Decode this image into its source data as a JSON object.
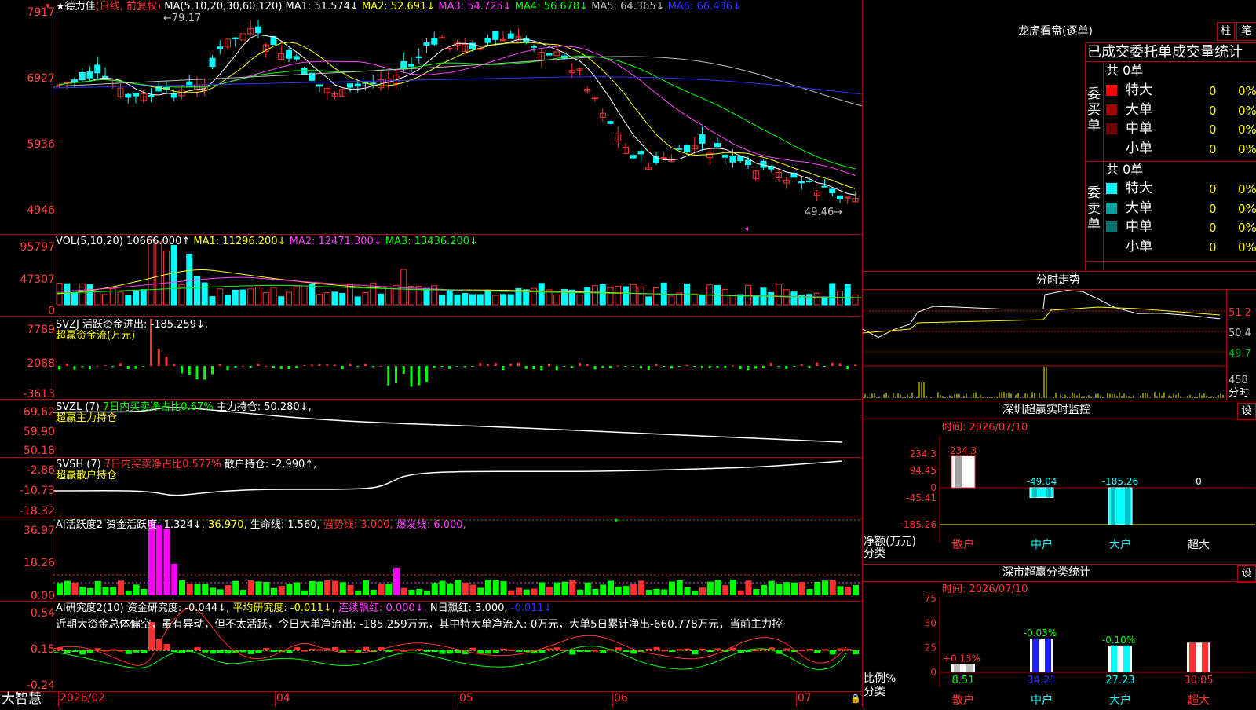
{
  "main": {
    "title_star": "★",
    "stock_name": "德力佳",
    "period": "(日线, 前复权)",
    "ma_label": "MA(5,10,20,30,60,120)",
    "ma1": "MA1: 51.574↓",
    "ma2": "MA2: 52.691↓",
    "ma3": "MA3: 54.725↓",
    "ma4": "MA4: 56.678↓",
    "ma5": "MA5: 64.365↓",
    "ma6": "MA6: 66.436↓",
    "high_mark": "←79.17",
    "low_mark": "49.46→",
    "y_ticks": [
      "7917",
      "6927",
      "5936",
      "4946"
    ]
  },
  "vol": {
    "label": "VOL(5,10,20)",
    "value": "10666.000↑",
    "ma1": "MA1: 11296.200↓",
    "ma2": "MA2: 12471.300↓",
    "ma3": "MA3: 13436.200↓",
    "y_ticks": [
      "95797",
      "47307",
      "0"
    ]
  },
  "svzj": {
    "label": "SVZJ",
    "title": "活跃资金进出: -185.259↓,",
    "subtitle": "超赢资金流(万元)",
    "y_ticks": [
      "7789",
      "2088",
      "-3613"
    ]
  },
  "svzl": {
    "label": "SVZL (7)",
    "ratio": "7日内买卖净占比0.67%",
    "hold": "主力持仓: 50.280↓,",
    "subtitle": "超赢主力持仓",
    "y_ticks": [
      "69.62",
      "59.90",
      "50.18"
    ]
  },
  "svsh": {
    "label": "SVSH (7)",
    "ratio": "7日内买卖净占比0.577%",
    "hold": "散户持仓: -2.990↑,",
    "subtitle": "超赢散户持仓",
    "y_ticks": [
      "-2.86",
      "-10.73",
      "-18.32"
    ]
  },
  "ai1": {
    "label": "AI活跃度2",
    "v1": "资金活跃度: 1.324↓,",
    "v2": "36.970,",
    "v3": "生命线: 1.560,",
    "v4": "强势线: 3.000,",
    "v5": "爆发线: 6.000,",
    "y_ticks": [
      "36.97",
      "18.26",
      "0.00"
    ]
  },
  "ai2": {
    "label": "AI研究度2(10)",
    "v1": "资金研究度: -0.044↓,",
    "v2": "平均研究度: -0.011↓,",
    "v3": "连续飘红: 0.000↓,",
    "v4": "N日飘红: 3.000,",
    "v5": "-0.011↓",
    "desc": "近期大资金总体偏空，虽有异动，但不太活跃，今日大单净流出: -185.259万元，其中特大单净流入: 0万元，大单5日累计净出-660.778万元，当前主力控",
    "y_ticks": [
      "0.54",
      "0.15",
      "-0.24"
    ]
  },
  "xaxis": {
    "brand": "大智慧",
    "labels": [
      "2026/02",
      "04",
      "05",
      "06",
      "07"
    ]
  },
  "lhb": {
    "title": "龙虎看盘(逐单)",
    "btn_bar": "柱",
    "btn_pen": "笔",
    "tabs": "已成交委托单成交量统计",
    "buy_side": "委买单",
    "sell_side": "委卖单",
    "buy_total": "共 0单",
    "sell_total": "共 0单",
    "buy_rows": [
      {
        "label": "特大",
        "count": "0",
        "pct": "0%",
        "color": "#ff0000"
      },
      {
        "label": "大单",
        "count": "0",
        "pct": "0%",
        "color": "#a00000"
      },
      {
        "label": "中单",
        "count": "0",
        "pct": "0%",
        "color": "#700000"
      },
      {
        "label": "小单",
        "count": "0",
        "pct": "0%",
        "color": "#000000"
      }
    ],
    "sell_rows": [
      {
        "label": "特大",
        "count": "0",
        "pct": "0%",
        "color": "#00ffff"
      },
      {
        "label": "大单",
        "count": "0",
        "pct": "0%",
        "color": "#00a0a0"
      },
      {
        "label": "中单",
        "count": "0",
        "pct": "0%",
        "color": "#007070"
      },
      {
        "label": "小单",
        "count": "0",
        "pct": "0%",
        "color": "#000000"
      }
    ]
  },
  "minute": {
    "title": "分时走势",
    "y_ticks": [
      "51.2",
      "50.4",
      "49.7"
    ],
    "vol_tick": "458",
    "unit": "分时"
  },
  "sz_monitor": {
    "title": "深圳超赢实时监控",
    "btn": "设",
    "time": "时间: 2026/07/10",
    "y_ticks": [
      "234.3",
      "94.45",
      "0",
      "-45.41",
      "-185.26"
    ],
    "ylabel": "净额(万元)",
    "xlabel": "分类",
    "categories": [
      "散户",
      "中户",
      "大户",
      "超大"
    ],
    "values": [
      234.3,
      -49.04,
      -185.26,
      0
    ],
    "value_labels": [
      "234.3",
      "-49.04",
      "-185.26",
      "0"
    ]
  },
  "sz_class": {
    "title": "深市超赢分类统计",
    "btn": "设",
    "time": "时间: 2026/07/10",
    "y_ticks": [
      "75",
      "50",
      "25",
      "0"
    ],
    "ylabel": "比例%",
    "xlabel": "分类",
    "categories": [
      "散户",
      "中户",
      "大户",
      "超大"
    ],
    "values": [
      8.51,
      34.21,
      27.23,
      30.05
    ],
    "value_labels": [
      "8.51",
      "34.21",
      "27.23",
      "30.05"
    ],
    "changes": [
      "+0.13%",
      "-0.03%",
      "-0.10%",
      ""
    ]
  }
}
